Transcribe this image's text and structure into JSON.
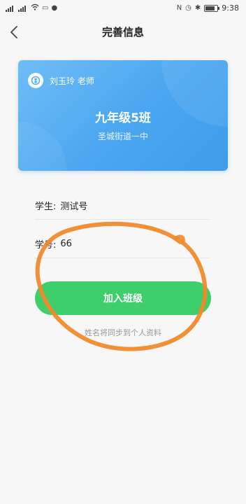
{
  "status_bar": {
    "left_icons": [
      "signal-icon",
      "wifi-icon",
      "message-icon",
      "notification-icon"
    ],
    "right_icons": [
      "nfc-icon",
      "alarm-icon",
      "bluetooth-icon",
      "battery-icon"
    ],
    "time": "9:38",
    "battery_level": 0.8
  },
  "nav": {
    "title": "完善信息"
  },
  "class_card": {
    "teacher": "刘玉玲 老师",
    "class_name": "九年级5班",
    "school": "圣城街道一中"
  },
  "form": {
    "student_label": "学生:",
    "student_value": "测试号",
    "student_number_label": "学号:",
    "student_number_value": "66"
  },
  "join_button_label": "加入班级",
  "sync_note": "姓名将同步到个人资料",
  "colors": {
    "card_gradient_start": "#6fbdf6",
    "card_gradient_end": "#3f9cec",
    "button_green": "#3fce6c",
    "annotation_orange": "#f08a2c"
  }
}
